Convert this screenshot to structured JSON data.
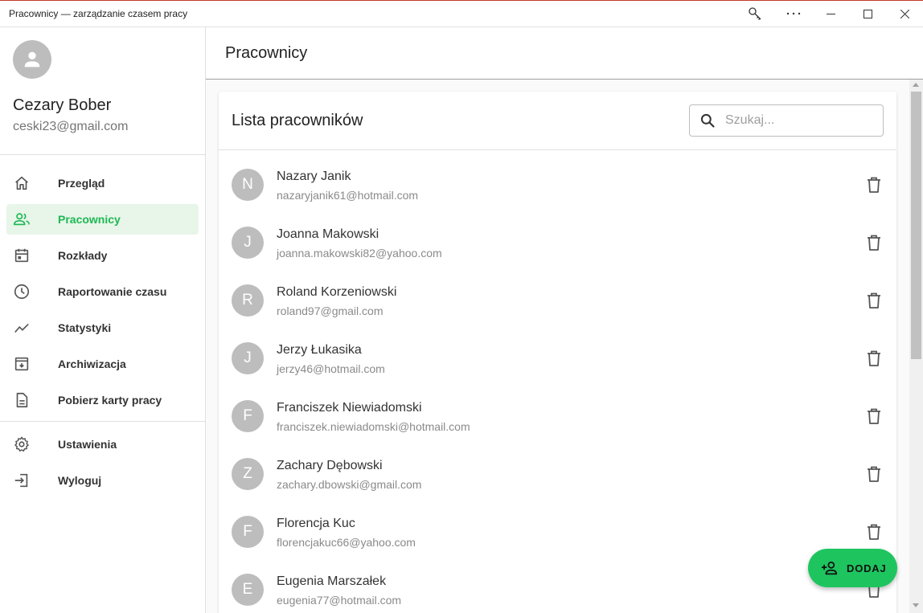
{
  "window": {
    "title": "Pracownicy — zarządzanie czasem pracy"
  },
  "user": {
    "name": "Cezary Bober",
    "email": "ceski23@gmail.com"
  },
  "nav": {
    "items": [
      {
        "label": "Przegląd",
        "icon": "home-icon"
      },
      {
        "label": "Pracownicy",
        "icon": "people-icon",
        "active": true
      },
      {
        "label": "Rozkłady",
        "icon": "calendar-icon"
      },
      {
        "label": "Raportowanie czasu",
        "icon": "clock-icon"
      },
      {
        "label": "Statystyki",
        "icon": "trending-line-icon"
      },
      {
        "label": "Archiwizacja",
        "icon": "archive-icon"
      },
      {
        "label": "Pobierz karty pracy",
        "icon": "document-icon"
      }
    ],
    "bottom_items": [
      {
        "label": "Ustawienia",
        "icon": "gear-icon"
      },
      {
        "label": "Wyloguj",
        "icon": "logout-icon"
      }
    ]
  },
  "header": {
    "title": "Pracownicy"
  },
  "employees": {
    "title": "Lista pracowników",
    "search_placeholder": "Szukaj...",
    "rows": [
      {
        "initial": "N",
        "name": "Nazary Janik",
        "email": "nazaryjanik61@hotmail.com"
      },
      {
        "initial": "J",
        "name": "Joanna Makowski",
        "email": "joanna.makowski82@yahoo.com"
      },
      {
        "initial": "R",
        "name": "Roland Korzeniowski",
        "email": "roland97@gmail.com"
      },
      {
        "initial": "J",
        "name": "Jerzy Łukasika",
        "email": "jerzy46@hotmail.com"
      },
      {
        "initial": "F",
        "name": "Franciszek Niewiadomski",
        "email": "franciszek.niewiadomski@hotmail.com"
      },
      {
        "initial": "Z",
        "name": "Zachary Dębowski",
        "email": "zachary.dbowski@gmail.com"
      },
      {
        "initial": "F",
        "name": "Florencja Kuc",
        "email": "florencjakuc66@yahoo.com"
      },
      {
        "initial": "E",
        "name": "Eugenia Marszałek",
        "email": "eugenia77@hotmail.com"
      }
    ]
  },
  "fab": {
    "label": "DODAJ",
    "icon": "add-person-icon"
  },
  "colors": {
    "accent": "#1ec55f",
    "active_nav_bg": "#e8f5e9",
    "avatar_bg": "#bdbdbd"
  }
}
